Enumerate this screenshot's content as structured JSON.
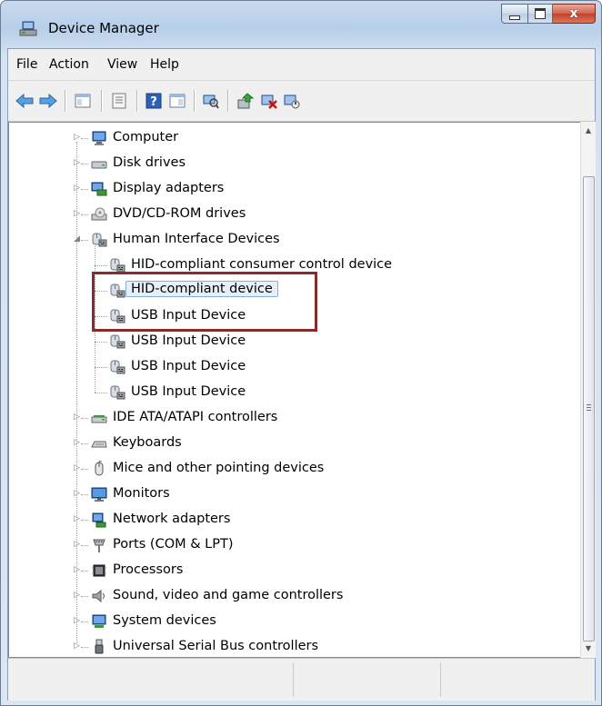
{
  "window": {
    "title": "Device Manager",
    "close_glyph": "x"
  },
  "menu": [
    "File",
    "Action",
    "View",
    "Help"
  ],
  "toolbar": {
    "icons": [
      "back-arrow-icon",
      "forward-arrow-icon",
      "show-hide-tree-icon",
      "properties-icon",
      "help-icon",
      "action-pane-icon",
      "scan-hardware-icon",
      "update-driver-icon",
      "uninstall-icon",
      "disable-device-icon"
    ]
  },
  "tree": {
    "categories": [
      {
        "label": "Computer",
        "icon": "computer-icon",
        "expanded": false
      },
      {
        "label": "Disk drives",
        "icon": "disk-drive-icon",
        "expanded": false
      },
      {
        "label": "Display adapters",
        "icon": "display-adapter-icon",
        "expanded": false
      },
      {
        "label": "DVD/CD-ROM drives",
        "icon": "dvd-drive-icon",
        "expanded": false
      },
      {
        "label": "Human Interface Devices",
        "icon": "hid-icon",
        "expanded": true,
        "children": [
          {
            "label": "HID-compliant consumer control device",
            "icon": "hid-icon"
          },
          {
            "label": "HID-compliant device",
            "icon": "hid-icon",
            "selected": true
          },
          {
            "label": "USB Input Device",
            "icon": "hid-icon"
          },
          {
            "label": "USB Input Device",
            "icon": "hid-icon"
          },
          {
            "label": "USB Input Device",
            "icon": "hid-icon"
          },
          {
            "label": "USB Input Device",
            "icon": "hid-icon"
          }
        ]
      },
      {
        "label": "IDE ATA/ATAPI controllers",
        "icon": "ide-controller-icon",
        "expanded": false
      },
      {
        "label": "Keyboards",
        "icon": "keyboard-icon",
        "expanded": false
      },
      {
        "label": "Mice and other pointing devices",
        "icon": "mouse-icon",
        "expanded": false
      },
      {
        "label": "Monitors",
        "icon": "monitor-icon",
        "expanded": false
      },
      {
        "label": "Network adapters",
        "icon": "network-adapter-icon",
        "expanded": false
      },
      {
        "label": "Ports (COM & LPT)",
        "icon": "port-icon",
        "expanded": false
      },
      {
        "label": "Processors",
        "icon": "processor-icon",
        "expanded": false
      },
      {
        "label": "Sound, video and game controllers",
        "icon": "sound-icon",
        "expanded": false
      },
      {
        "label": "System devices",
        "icon": "system-devices-icon",
        "expanded": false
      },
      {
        "label": "Universal Serial Bus controllers",
        "icon": "usb-icon",
        "expanded": false
      }
    ]
  },
  "colors": {
    "highlight_box": "#8b2a2a",
    "selection_bg": "#e5f0fb",
    "selection_border": "#84acdd"
  }
}
